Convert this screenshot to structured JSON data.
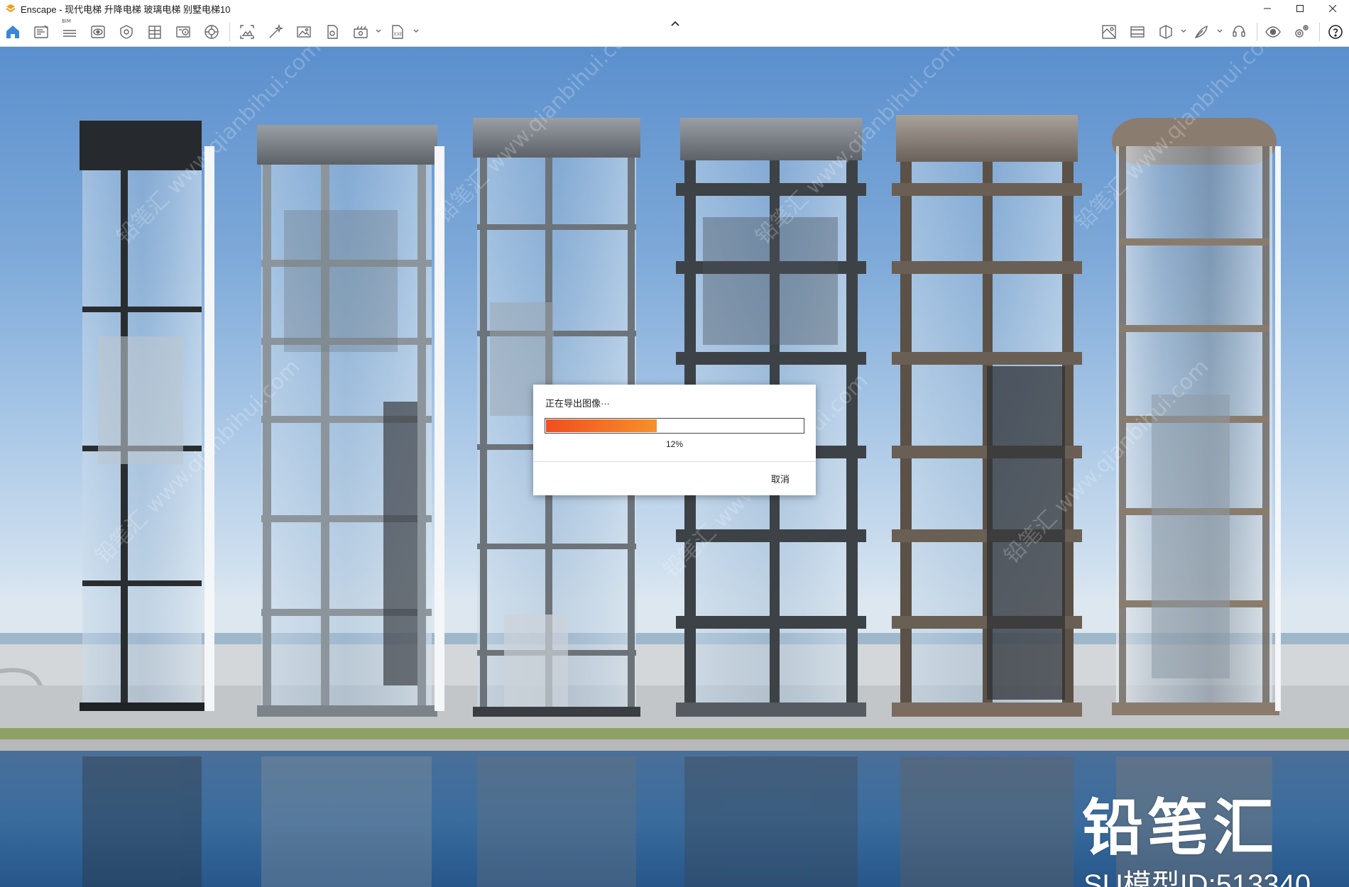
{
  "window": {
    "title": "Enscape - 现代电梯 升降电梯 玻璃电梯 别墅电梯10",
    "logo": "enscape-logo",
    "brand_color": "#f39c12"
  },
  "toolbar": {
    "left_icons": [
      "home-icon",
      "document-icon",
      "bim-icon",
      "visual-settings-icon",
      "view-icon",
      "shield-icon",
      "building-icon",
      "info-icon",
      "settings-wheel-icon"
    ],
    "bim_label": "BIM",
    "right_icons": [
      "screenshot-icon",
      "batch-render-icon",
      "panorama-icon",
      "video-icon",
      "export-icon",
      "map-icon",
      "video-editor-icon",
      "layers-icon",
      "asset-library-icon",
      "collaborative-annotation-icon",
      "visibility-icon",
      "settings-icon",
      "help-icon"
    ],
    "accent_color": "#3a86d8"
  },
  "dialog": {
    "title": "正在导出图像···",
    "progress": 0.12,
    "percent_label": "12%",
    "cancel_label": "取消"
  },
  "watermark": {
    "brand": "铅笔汇",
    "model_id": "SU模型ID:513340",
    "diagonal_text": "铅笔汇 www.qianbihui.com"
  }
}
